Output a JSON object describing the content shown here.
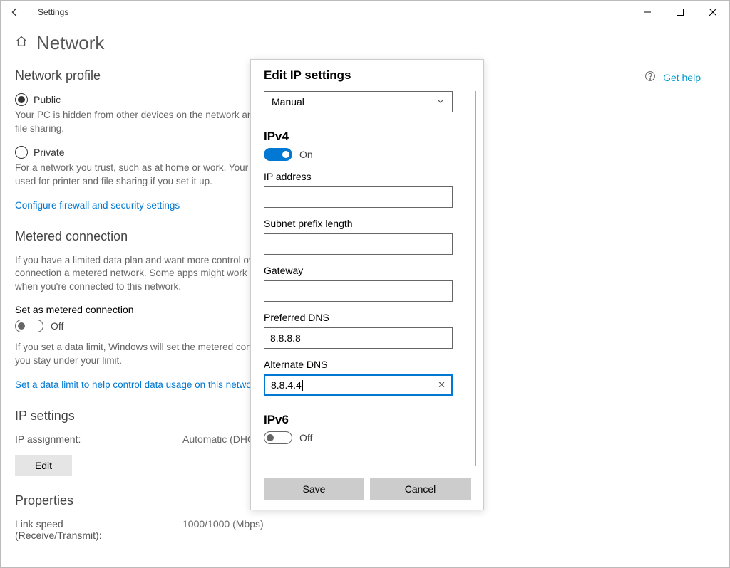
{
  "window": {
    "title": "Settings"
  },
  "page": {
    "title": "Network"
  },
  "help": {
    "label": "Get help"
  },
  "profile": {
    "heading": "Network profile",
    "public_label": "Public",
    "public_desc": "Your PC is hidden from other devices on the network and can't be used for printer and file sharing.",
    "private_label": "Private",
    "private_desc": "For a network you trust, such as at home or work. Your PC is discoverable and can be used for printer and file sharing if you set it up.",
    "firewall_link": "Configure firewall and security settings"
  },
  "metered": {
    "heading": "Metered connection",
    "desc": "If you have a limited data plan and want more control over data usage, make this connection a metered network. Some apps might work differently to reduce data usage when you're connected to this network.",
    "toggle_label": "Set as metered connection",
    "toggle_state": "Off",
    "note": "If you set a data limit, Windows will set the metered connection setting for you to help you stay under your limit.",
    "limit_link": "Set a data limit to help control data usage on this network"
  },
  "ip": {
    "heading": "IP settings",
    "assign_label": "IP assignment:",
    "assign_value": "Automatic (DHCP)",
    "edit_label": "Edit"
  },
  "props": {
    "heading": "Properties",
    "k1": "Link speed (Receive/Transmit):",
    "v1": "1000/1000 (Mbps)"
  },
  "dialog": {
    "title": "Edit IP settings",
    "mode": "Manual",
    "ipv4_heading": "IPv4",
    "ipv4_state": "On",
    "ip_label": "IP address",
    "ip_value": "",
    "subnet_label": "Subnet prefix length",
    "subnet_value": "",
    "gateway_label": "Gateway",
    "gateway_value": "",
    "pref_dns_label": "Preferred DNS",
    "pref_dns_value": "8.8.8.8",
    "alt_dns_label": "Alternate DNS",
    "alt_dns_value": "8.8.4.4",
    "ipv6_heading": "IPv6",
    "ipv6_state": "Off",
    "save": "Save",
    "cancel": "Cancel"
  }
}
